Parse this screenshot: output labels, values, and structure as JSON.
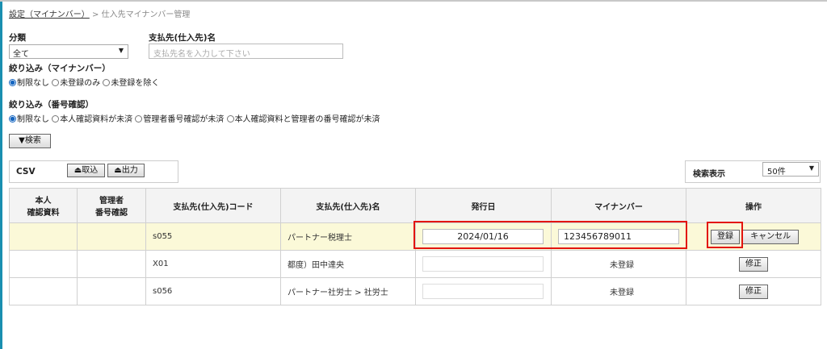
{
  "breadcrumb": {
    "parent": "設定（マイナンバー）",
    "separator": ">",
    "current": "仕入先マイナンバー管理"
  },
  "filters": {
    "category_label": "分類",
    "category_value": "全て",
    "payee_label": "支払先(仕入先)名",
    "payee_placeholder": "支払先名を入力して下さい",
    "mynumber_label": "絞り込み（マイナンバー）",
    "mynumber_options": [
      "制限なし",
      "未登録のみ",
      "未登録を除く"
    ],
    "number_check_label": "絞り込み（番号確認）",
    "number_check_options": [
      "制限なし",
      "本人確認資料が未済",
      "管理者番号確認が未済",
      "本人確認資料と管理者の番号確認が未済"
    ],
    "search_button": "▼検索"
  },
  "csv": {
    "label": "CSV",
    "import_button": "取込",
    "export_button": "出力"
  },
  "display": {
    "label": "検索表示",
    "value": "50件"
  },
  "table": {
    "headers": {
      "identity_doc": [
        "本人",
        "確認資料"
      ],
      "admin_check": [
        "管理者",
        "番号確認"
      ],
      "code": "支払先(仕入先)コード",
      "name": "支払先(仕入先)名",
      "issue_date": "発行日",
      "mynumber": "マイナンバー",
      "actions": "操作"
    },
    "rows": [
      {
        "code": "s055",
        "name": "パートナー税理士",
        "issue_date": "2024/01/16",
        "mynumber": "123456789011",
        "register": "登録",
        "cancel": "キャンセル"
      },
      {
        "code": "X01",
        "name": "都度）田中達央",
        "status": "未登録",
        "edit": "修正"
      },
      {
        "code": "s056",
        "name": "パートナー社労士 > 社労士",
        "status": "未登録",
        "edit": "修正"
      }
    ]
  },
  "colors": {
    "accent": "#1a8fb0",
    "highlight_row": "#fbf9d8",
    "unregistered": "#e0211a",
    "annotation": "#e3140e"
  }
}
